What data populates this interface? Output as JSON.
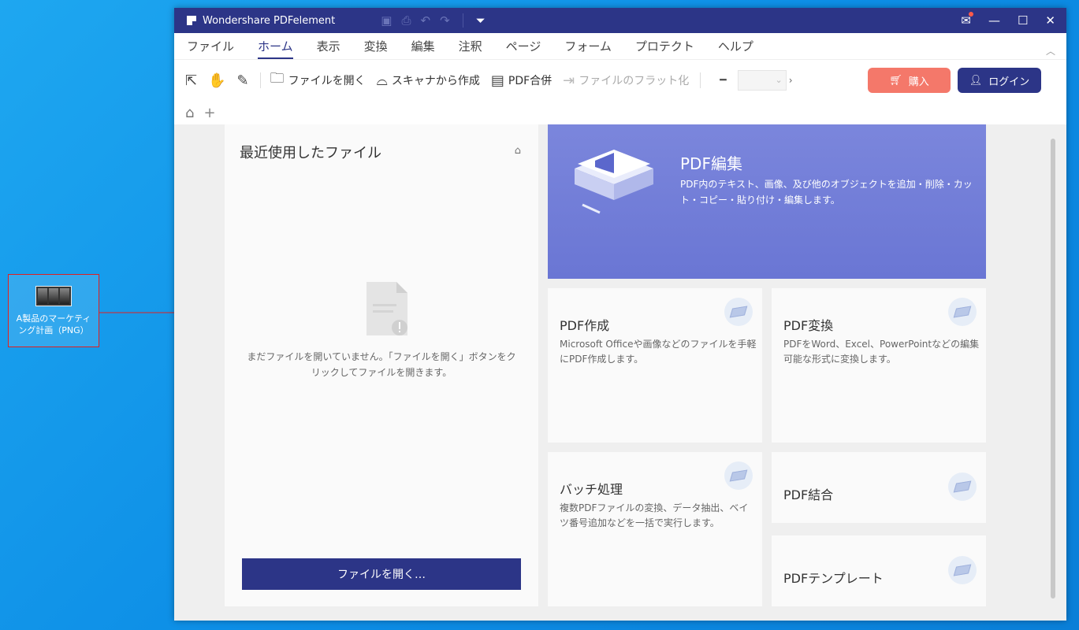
{
  "desktop": {
    "icon_label": "A製品のマーケティング計画（PNG）"
  },
  "window": {
    "title": "Wondershare PDFelement",
    "titlebar_icons": [
      "save-icon",
      "print-icon",
      "undo-icon",
      "redo-icon",
      "dropdown-icon"
    ],
    "controls": [
      "mail-icon",
      "minimize-icon",
      "maximize-icon",
      "close-icon"
    ]
  },
  "menu": {
    "items": [
      "ファイル",
      "ホーム",
      "表示",
      "変換",
      "編集",
      "注釈",
      "ページ",
      "フォーム",
      "プロテクト",
      "ヘルプ"
    ],
    "active": "ホーム"
  },
  "toolbar": {
    "open_file": "ファイルを開く",
    "scanner": "スキャナから作成",
    "merge": "PDF合併",
    "flatten": "ファイルのフラット化",
    "buy": "購入",
    "login": "ログイン"
  },
  "recent": {
    "title": "最近使用したファイル",
    "empty_message": "まだファイルを開いていません。「ファイルを開く」ボタンをクリックしてファイルを開きます。",
    "open_button": "ファイルを開く…"
  },
  "hero": {
    "title": "PDF編集",
    "description": "PDF内のテキスト、画像、及び他のオブジェクトを追加・削除・カット・コピー・貼り付け・編集します。"
  },
  "cards": {
    "create": {
      "title": "PDF作成",
      "description": "Microsoft Officeや画像などのファイルを手軽にPDF作成します。"
    },
    "convert": {
      "title": "PDF変換",
      "description": "PDFをWord、Excel、PowerPointなどの編集可能な形式に変換します。"
    },
    "batch": {
      "title": "バッチ処理",
      "description": "複数PDFファイルの変換、データ抽出、ベイツ番号追加などを一括で実行します。"
    },
    "combine": {
      "title": "PDF結合"
    },
    "template": {
      "title": "PDFテンプレート"
    }
  },
  "colors": {
    "brand": "#2c3587",
    "buy": "#f4786a",
    "hero": "#7380d8"
  }
}
